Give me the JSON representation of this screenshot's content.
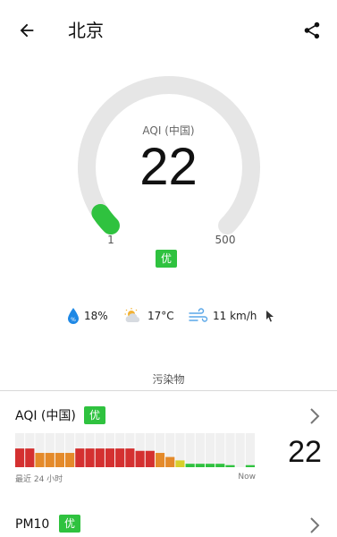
{
  "header": {
    "city": "北京"
  },
  "gauge": {
    "caption": "AQI (中国)",
    "value": 22,
    "value_text": "22",
    "min_label": "1",
    "max_label": "500",
    "scale_min": 1,
    "scale_max": 500,
    "level": "优",
    "fill_color": "#2fc23f",
    "track_color": "#e6e6e6"
  },
  "weather": {
    "humidity": "18%",
    "temperature": "17°C",
    "wind": "11 km/h"
  },
  "pollutants": {
    "section_title": "污染物",
    "items": [
      {
        "name": "AQI (中国)",
        "level": "优",
        "value": "22",
        "history_left_label": "最近 24 小时",
        "history_right_label": "Now",
        "history": [
          {
            "v": 0.55,
            "c": "#d43030"
          },
          {
            "v": 0.55,
            "c": "#d43030"
          },
          {
            "v": 0.42,
            "c": "#e48a2a"
          },
          {
            "v": 0.42,
            "c": "#e48a2a"
          },
          {
            "v": 0.42,
            "c": "#e48a2a"
          },
          {
            "v": 0.42,
            "c": "#e48a2a"
          },
          {
            "v": 0.55,
            "c": "#d43030"
          },
          {
            "v": 0.55,
            "c": "#d43030"
          },
          {
            "v": 0.55,
            "c": "#d43030"
          },
          {
            "v": 0.55,
            "c": "#d43030"
          },
          {
            "v": 0.55,
            "c": "#d43030"
          },
          {
            "v": 0.55,
            "c": "#d43030"
          },
          {
            "v": 0.48,
            "c": "#d43030"
          },
          {
            "v": 0.48,
            "c": "#d43030"
          },
          {
            "v": 0.42,
            "c": "#e48a2a"
          },
          {
            "v": 0.3,
            "c": "#e48a2a"
          },
          {
            "v": 0.2,
            "c": "#d8cf2a"
          },
          {
            "v": 0.1,
            "c": "#2fc23f"
          },
          {
            "v": 0.1,
            "c": "#2fc23f"
          },
          {
            "v": 0.1,
            "c": "#2fc23f"
          },
          {
            "v": 0.1,
            "c": "#2fc23f"
          },
          {
            "v": 0.06,
            "c": "#2fc23f"
          },
          {
            "v": 0.0,
            "c": "#2fc23f"
          },
          {
            "v": 0.06,
            "c": "#2fc23f"
          }
        ]
      },
      {
        "name": "PM10",
        "level": "优"
      }
    ]
  }
}
